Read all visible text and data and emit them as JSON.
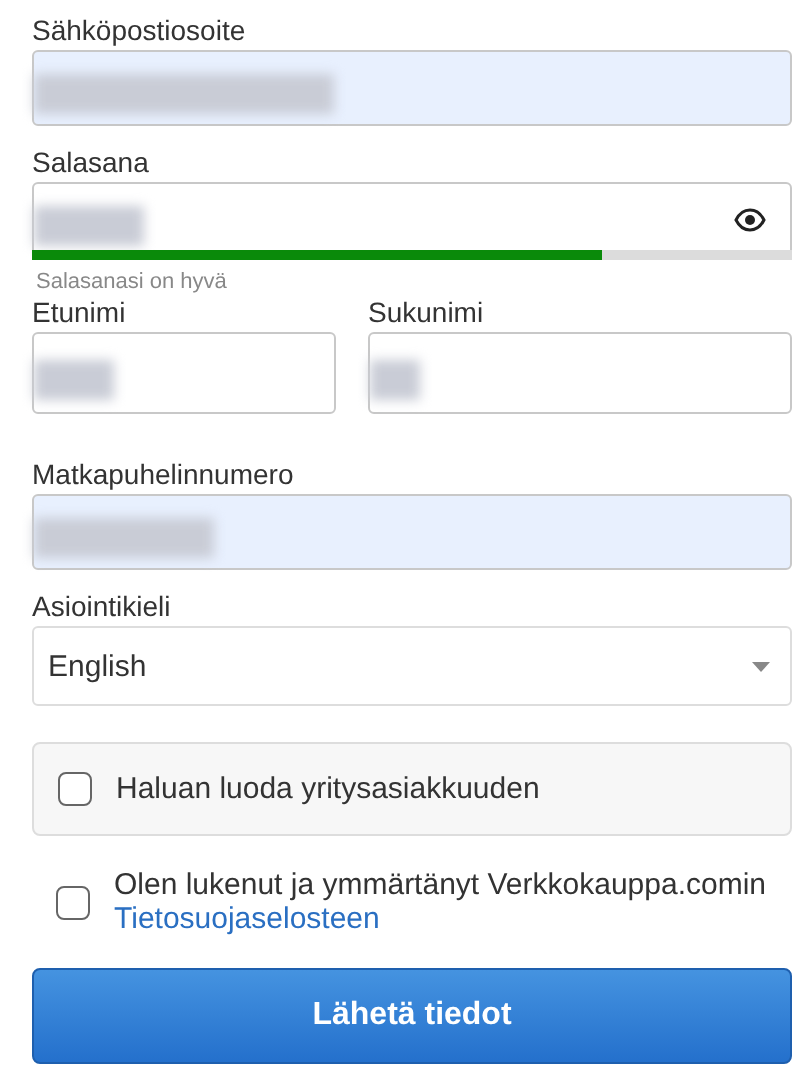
{
  "email": {
    "label": "Sähköpostiosoite",
    "autofilled": true,
    "redacted": true
  },
  "password": {
    "label": "Salasana",
    "autofilled": false,
    "redacted": true,
    "strength": {
      "level": 0.75,
      "hint": "Salasanasi on hyvä"
    }
  },
  "name_fields": [
    {
      "label": "Etunimi",
      "autofilled": false,
      "redacted": true
    },
    {
      "label": "Sukunimi",
      "autofilled": false,
      "redacted": true
    }
  ],
  "phone": {
    "label": "Matkapuhelinnumero",
    "autofilled": true,
    "redacted": true
  },
  "language": {
    "label": "Asiointikieli",
    "value": "English"
  },
  "business_checkbox": {
    "label": "Haluan luoda yritysasiakkuuden",
    "checked": false
  },
  "privacy_checkbox": {
    "text": "Olen lukenut ja ymmärtänyt Verkkokauppa.comin",
    "link": "Tietosuojaselosteen",
    "checked": false
  },
  "submit_button": "Lähetä tiedot"
}
